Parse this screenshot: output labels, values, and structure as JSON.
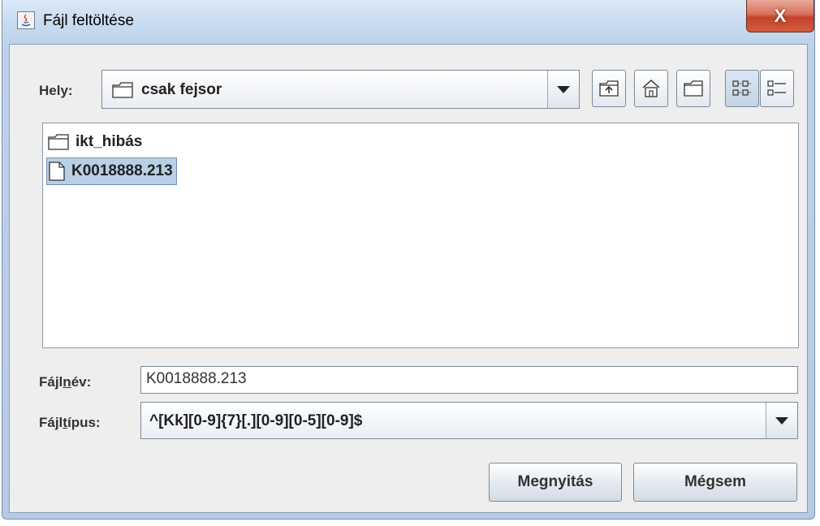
{
  "window": {
    "title": "Fájl feltöltése",
    "close_glyph": "X"
  },
  "location": {
    "label": "Hely:",
    "value": "csak fejsor"
  },
  "toolbar": {
    "icons": [
      "up-folder-icon",
      "home-icon",
      "new-folder-icon",
      "list-view-icon",
      "details-view-icon"
    ]
  },
  "files": [
    {
      "name": "ikt_hibás",
      "type": "folder",
      "selected": false
    },
    {
      "name": "K0018888.213",
      "type": "file",
      "selected": true
    }
  ],
  "filename": {
    "label_pre": "Fájl",
    "label_mnemonic": "n",
    "label_post": "év:",
    "value": "K0018888.213"
  },
  "filetype": {
    "label_pre": "Fájl",
    "label_mnemonic": "t",
    "label_post": "ípus:",
    "value": "^[Kk][0-9]{7}[.][0-9][0-5][0-9]$"
  },
  "buttons": {
    "open": "Megnyitás",
    "cancel": "Mégsem"
  },
  "colors": {
    "selection": "#b8cfe5",
    "close_button": "#c2412a"
  }
}
